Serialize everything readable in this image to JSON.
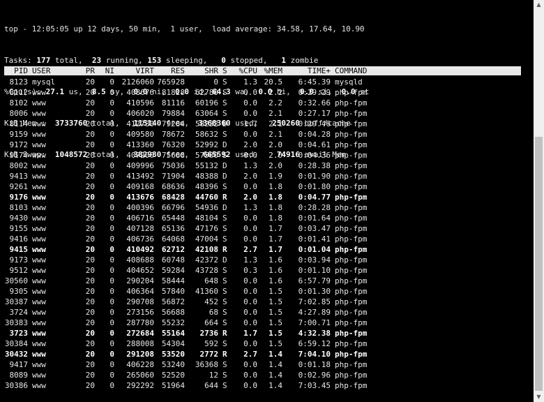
{
  "summary": {
    "line1": "top - 12:05:05 up 12 days, 50 min,  1 user,  load average: 34.58, 17.64, 10.90",
    "tasks": {
      "prefix": "Tasks: ",
      "total": "177",
      "total_label": " total,  ",
      "running": "23",
      "running_label": " running, ",
      "sleeping": "153",
      "sleeping_label": " sleeping,   ",
      "stopped": "0",
      "stopped_label": " stopped,   ",
      "zombie": "1",
      "zombie_label": " zombie"
    },
    "cpu": {
      "prefix": "%Cpu(s): ",
      "us": "27.1",
      "us_label": " us,  ",
      "sy": "8.5",
      "sy_label": " sy,  ",
      "ni": "0.0",
      "ni_label": " ni,  ",
      "id": "0.0",
      "id_label": " id, ",
      "wa": "64.3",
      "wa_label": " wa,  ",
      "hi": "0.0",
      "hi_label": " hi,  ",
      "si": "0.0",
      "si_label": " si,  ",
      "st": "0.0",
      "st_label": " st"
    },
    "mem": {
      "prefix": "KiB Mem :  ",
      "total": "3733760",
      "total_label": " total,   ",
      "free": "115140",
      "free_label": " free,  ",
      "used": "3368360",
      "used_label": " used,   ",
      "buff": "250260",
      "buff_label": " buff/cache"
    },
    "swap": {
      "prefix": "KiB Swap:  ",
      "total": "1048572",
      "total_label": " total,   ",
      "free": "382980",
      "free_label": " free,   ",
      "used": "665592",
      "used_label": " used.    ",
      "avail": "74916",
      "avail_label": " avail Mem"
    }
  },
  "columns": {
    "pid": "PID",
    "user": "USER",
    "pr": "PR",
    "ni": "NI",
    "virt": "VIRT",
    "res": "RES",
    "shr": "SHR",
    "s": "S",
    "cpu": "%CPU",
    "mem": "%MEM",
    "time": "TIME+",
    "cmd": "COMMAND"
  },
  "processes": [
    {
      "pid": "8123",
      "user": "mysql",
      "pr": "20",
      "ni": "0",
      "virt": "2126060",
      "res": "765928",
      "shr": "0",
      "s": "S",
      "cpu": "1.3",
      "mem": "20.5",
      "time": "6:45.39",
      "cmd": "mysqld",
      "bold": false
    },
    {
      "pid": "8112",
      "user": "www",
      "pr": "20",
      "ni": "0",
      "virt": "408676",
      "res": "81828",
      "shr": "62780",
      "s": "S",
      "cpu": "0.0",
      "mem": "2.2",
      "time": "0:29.29",
      "cmd": "php-fpm",
      "bold": false
    },
    {
      "pid": "8102",
      "user": "www",
      "pr": "20",
      "ni": "0",
      "virt": "410596",
      "res": "81116",
      "shr": "60196",
      "s": "S",
      "cpu": "0.0",
      "mem": "2.2",
      "time": "0:32.66",
      "cmd": "php-fpm",
      "bold": false
    },
    {
      "pid": "8006",
      "user": "www",
      "pr": "20",
      "ni": "0",
      "virt": "406020",
      "res": "79884",
      "shr": "63064",
      "s": "S",
      "cpu": "0.0",
      "mem": "2.1",
      "time": "0:27.17",
      "cmd": "php-fpm",
      "bold": false
    },
    {
      "pid": "8114",
      "user": "www",
      "pr": "20",
      "ni": "0",
      "virt": "412780",
      "res": "79284",
      "shr": "58232",
      "s": "D",
      "cpu": "1.7",
      "mem": "2.1",
      "time": "0:29.46",
      "cmd": "php-fpm",
      "bold": false
    },
    {
      "pid": "9159",
      "user": "www",
      "pr": "20",
      "ni": "0",
      "virt": "409580",
      "res": "78672",
      "shr": "58632",
      "s": "S",
      "cpu": "0.0",
      "mem": "2.1",
      "time": "0:04.28",
      "cmd": "php-fpm",
      "bold": false
    },
    {
      "pid": "9172",
      "user": "www",
      "pr": "20",
      "ni": "0",
      "virt": "413360",
      "res": "76320",
      "shr": "52992",
      "s": "D",
      "cpu": "2.0",
      "mem": "2.0",
      "time": "0:04.61",
      "cmd": "php-fpm",
      "bold": false
    },
    {
      "pid": "9174",
      "user": "www",
      "pr": "20",
      "ni": "0",
      "virt": "407200",
      "res": "75688",
      "shr": "57500",
      "s": "S",
      "cpu": "0.0",
      "mem": "2.0",
      "time": "0:04.36",
      "cmd": "php-fpm",
      "bold": false
    },
    {
      "pid": "8002",
      "user": "www",
      "pr": "20",
      "ni": "0",
      "virt": "409996",
      "res": "75036",
      "shr": "55132",
      "s": "D",
      "cpu": "1.3",
      "mem": "2.0",
      "time": "0:28.38",
      "cmd": "php-fpm",
      "bold": false
    },
    {
      "pid": "9413",
      "user": "www",
      "pr": "20",
      "ni": "0",
      "virt": "413492",
      "res": "71904",
      "shr": "48388",
      "s": "D",
      "cpu": "2.0",
      "mem": "1.9",
      "time": "0:01.90",
      "cmd": "php-fpm",
      "bold": false
    },
    {
      "pid": "9261",
      "user": "www",
      "pr": "20",
      "ni": "0",
      "virt": "409168",
      "res": "68636",
      "shr": "48396",
      "s": "S",
      "cpu": "0.0",
      "mem": "1.8",
      "time": "0:01.80",
      "cmd": "php-fpm",
      "bold": false
    },
    {
      "pid": "9176",
      "user": "www",
      "pr": "20",
      "ni": "0",
      "virt": "413676",
      "res": "68428",
      "shr": "44760",
      "s": "R",
      "cpu": "2.0",
      "mem": "1.8",
      "time": "0:04.77",
      "cmd": "php-fpm",
      "bold": true
    },
    {
      "pid": "8103",
      "user": "www",
      "pr": "20",
      "ni": "0",
      "virt": "400396",
      "res": "66796",
      "shr": "54936",
      "s": "D",
      "cpu": "1.3",
      "mem": "1.8",
      "time": "0:28.28",
      "cmd": "php-fpm",
      "bold": false
    },
    {
      "pid": "9430",
      "user": "www",
      "pr": "20",
      "ni": "0",
      "virt": "406716",
      "res": "65448",
      "shr": "48104",
      "s": "S",
      "cpu": "0.0",
      "mem": "1.8",
      "time": "0:01.64",
      "cmd": "php-fpm",
      "bold": false
    },
    {
      "pid": "9155",
      "user": "www",
      "pr": "20",
      "ni": "0",
      "virt": "407128",
      "res": "65136",
      "shr": "47176",
      "s": "S",
      "cpu": "0.0",
      "mem": "1.7",
      "time": "0:03.47",
      "cmd": "php-fpm",
      "bold": false
    },
    {
      "pid": "9416",
      "user": "www",
      "pr": "20",
      "ni": "0",
      "virt": "406736",
      "res": "64068",
      "shr": "47004",
      "s": "S",
      "cpu": "0.0",
      "mem": "1.7",
      "time": "0:01.41",
      "cmd": "php-fpm",
      "bold": false
    },
    {
      "pid": "9415",
      "user": "www",
      "pr": "20",
      "ni": "0",
      "virt": "410492",
      "res": "62712",
      "shr": "42108",
      "s": "R",
      "cpu": "2.7",
      "mem": "1.7",
      "time": "0:01.04",
      "cmd": "php-fpm",
      "bold": true
    },
    {
      "pid": "9173",
      "user": "www",
      "pr": "20",
      "ni": "0",
      "virt": "408688",
      "res": "60748",
      "shr": "42372",
      "s": "D",
      "cpu": "1.3",
      "mem": "1.6",
      "time": "0:03.94",
      "cmd": "php-fpm",
      "bold": false
    },
    {
      "pid": "9512",
      "user": "www",
      "pr": "20",
      "ni": "0",
      "virt": "404652",
      "res": "59284",
      "shr": "43728",
      "s": "S",
      "cpu": "0.3",
      "mem": "1.6",
      "time": "0:01.10",
      "cmd": "php-fpm",
      "bold": false
    },
    {
      "pid": "30560",
      "user": "www",
      "pr": "20",
      "ni": "0",
      "virt": "290204",
      "res": "58444",
      "shr": "648",
      "s": "S",
      "cpu": "0.0",
      "mem": "1.6",
      "time": "6:57.79",
      "cmd": "php-fpm",
      "bold": false
    },
    {
      "pid": "9305",
      "user": "www",
      "pr": "20",
      "ni": "0",
      "virt": "406364",
      "res": "57840",
      "shr": "41360",
      "s": "S",
      "cpu": "0.0",
      "mem": "1.5",
      "time": "0:01.30",
      "cmd": "php-fpm",
      "bold": false
    },
    {
      "pid": "30387",
      "user": "www",
      "pr": "20",
      "ni": "0",
      "virt": "290708",
      "res": "56872",
      "shr": "452",
      "s": "S",
      "cpu": "0.0",
      "mem": "1.5",
      "time": "7:02.85",
      "cmd": "php-fpm",
      "bold": false
    },
    {
      "pid": "3724",
      "user": "www",
      "pr": "20",
      "ni": "0",
      "virt": "273156",
      "res": "56688",
      "shr": "68",
      "s": "S",
      "cpu": "0.0",
      "mem": "1.5",
      "time": "4:27.89",
      "cmd": "php-fpm",
      "bold": false
    },
    {
      "pid": "30383",
      "user": "www",
      "pr": "20",
      "ni": "0",
      "virt": "287780",
      "res": "55232",
      "shr": "664",
      "s": "S",
      "cpu": "0.0",
      "mem": "1.5",
      "time": "7:00.71",
      "cmd": "php-fpm",
      "bold": false
    },
    {
      "pid": "3723",
      "user": "www",
      "pr": "20",
      "ni": "0",
      "virt": "272684",
      "res": "55164",
      "shr": "2736",
      "s": "R",
      "cpu": "1.7",
      "mem": "1.5",
      "time": "4:32.38",
      "cmd": "php-fpm",
      "bold": true
    },
    {
      "pid": "30384",
      "user": "www",
      "pr": "20",
      "ni": "0",
      "virt": "288008",
      "res": "54304",
      "shr": "592",
      "s": "S",
      "cpu": "0.0",
      "mem": "1.5",
      "time": "6:59.12",
      "cmd": "php-fpm",
      "bold": false
    },
    {
      "pid": "30432",
      "user": "www",
      "pr": "20",
      "ni": "0",
      "virt": "291208",
      "res": "53520",
      "shr": "2772",
      "s": "R",
      "cpu": "2.7",
      "mem": "1.4",
      "time": "7:04.10",
      "cmd": "php-fpm",
      "bold": true
    },
    {
      "pid": "9417",
      "user": "www",
      "pr": "20",
      "ni": "0",
      "virt": "406228",
      "res": "53240",
      "shr": "36368",
      "s": "S",
      "cpu": "0.0",
      "mem": "1.4",
      "time": "0:01.18",
      "cmd": "php-fpm",
      "bold": false
    },
    {
      "pid": "8089",
      "user": "www",
      "pr": "20",
      "ni": "0",
      "virt": "265060",
      "res": "52520",
      "shr": "12",
      "s": "S",
      "cpu": "0.0",
      "mem": "1.4",
      "time": "0:02.96",
      "cmd": "php-fpm",
      "bold": false
    },
    {
      "pid": "30386",
      "user": "www",
      "pr": "20",
      "ni": "0",
      "virt": "292292",
      "res": "51964",
      "shr": "644",
      "s": "S",
      "cpu": "0.0",
      "mem": "1.4",
      "time": "7:03.45",
      "cmd": "php-fpm",
      "bold": false
    }
  ],
  "scrollbar": {
    "up_icon": "triangle-up",
    "down_icon": "triangle-down"
  },
  "colors": {
    "background": "#000000",
    "text": "#e6e6e6",
    "header_bar": "#e8e8e8"
  }
}
